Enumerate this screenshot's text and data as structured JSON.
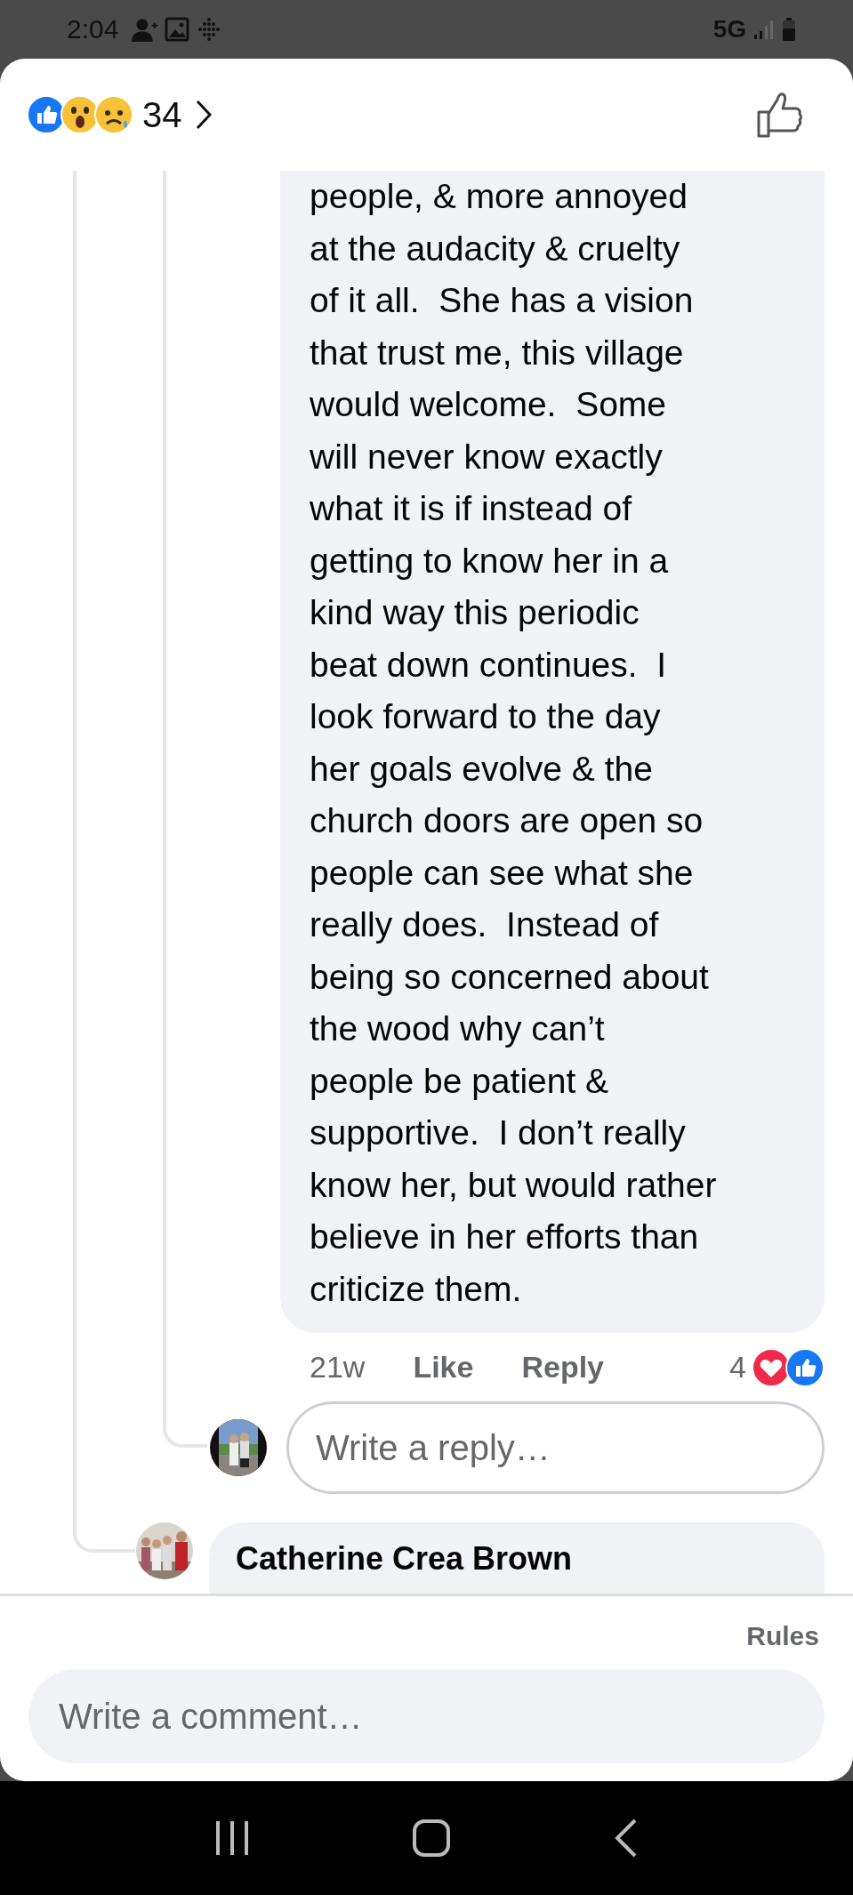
{
  "status_bar": {
    "time": "2:04",
    "network": "5G"
  },
  "header": {
    "reaction_count": "34"
  },
  "comment": {
    "lines": [
      "people, & more annoyed",
      "at the audacity & cruelty",
      "of it all.  She has a vision",
      "that trust me, this village",
      "would welcome.  Some",
      "will never know exactly",
      "what it is if instead of",
      "getting to know her in a",
      "kind way this periodic",
      "beat down continues.  I",
      "look forward to the day",
      "her goals evolve & the",
      "church doors are open so",
      "people can see what she",
      "really does.  Instead of",
      "being so concerned about",
      "the wood why can’t",
      "people be patient &",
      "supportive.  I don’t really",
      "know her, but would rather",
      "believe in her efforts than",
      "criticize them."
    ],
    "time": "21w",
    "like": "Like",
    "reply": "Reply",
    "reaction_count": "4"
  },
  "reply_field": {
    "placeholder": "Write a reply…"
  },
  "next_comment": {
    "author": "Catherine Crea Brown"
  },
  "footer": {
    "rules": "Rules",
    "comment_field": {
      "placeholder": "Write a comment…"
    }
  }
}
